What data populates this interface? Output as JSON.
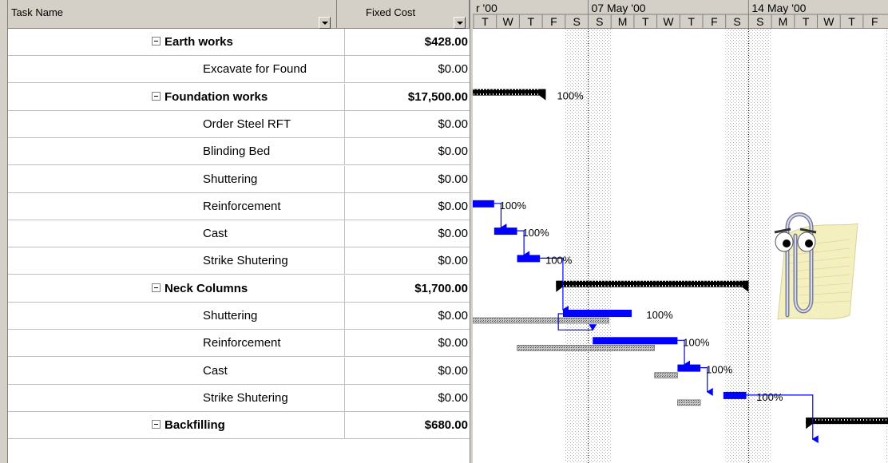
{
  "columns": {
    "task_name": "Task Name",
    "fixed_cost": "Fixed Cost"
  },
  "timescale": {
    "weeks": [
      "r '00",
      "07 May '00",
      "14 May '00"
    ],
    "days_week1": [
      "T",
      "W",
      "T",
      "F",
      "S"
    ],
    "days_week2": [
      "S",
      "M",
      "T",
      "W",
      "T",
      "F",
      "S"
    ],
    "days_week3": [
      "S",
      "M",
      "T",
      "W",
      "T",
      "F"
    ]
  },
  "tasks": [
    {
      "name": "Earth works",
      "cost": "$428.00",
      "summary": true
    },
    {
      "name": "Excavate for Found",
      "cost": "$0.00",
      "summary": false
    },
    {
      "name": "Foundation works",
      "cost": "$17,500.00",
      "summary": true
    },
    {
      "name": "Order Steel RFT",
      "cost": "$0.00",
      "summary": false
    },
    {
      "name": "Blinding Bed",
      "cost": "$0.00",
      "summary": false
    },
    {
      "name": "Shuttering",
      "cost": "$0.00",
      "summary": false
    },
    {
      "name": "Reinforcement",
      "cost": "$0.00",
      "summary": false
    },
    {
      "name": "Cast",
      "cost": "$0.00",
      "summary": false
    },
    {
      "name": "Strike Shutering",
      "cost": "$0.00",
      "summary": false
    },
    {
      "name": "Neck Columns",
      "cost": "$1,700.00",
      "summary": true
    },
    {
      "name": "Shuttering",
      "cost": "$0.00",
      "summary": false
    },
    {
      "name": "Reinforcement",
      "cost": "$0.00",
      "summary": false
    },
    {
      "name": "Cast",
      "cost": "$0.00",
      "summary": false
    },
    {
      "name": "Strike Shutering",
      "cost": "$0.00",
      "summary": false
    },
    {
      "name": "Backfilling",
      "cost": "$680.00",
      "summary": true
    }
  ],
  "percent_labels": [
    "100%",
    "100%",
    "100%",
    "100%",
    "100%",
    "100%",
    "100%",
    "100%"
  ],
  "colors": {
    "task_bar": "#0000ff",
    "summary_bar": "#000000",
    "baseline_bar": "#808080",
    "nonworking": "#e4e4e4",
    "header_bg": "#d4d0c8"
  },
  "assistant_icon": "paperclip-assistant-icon"
}
